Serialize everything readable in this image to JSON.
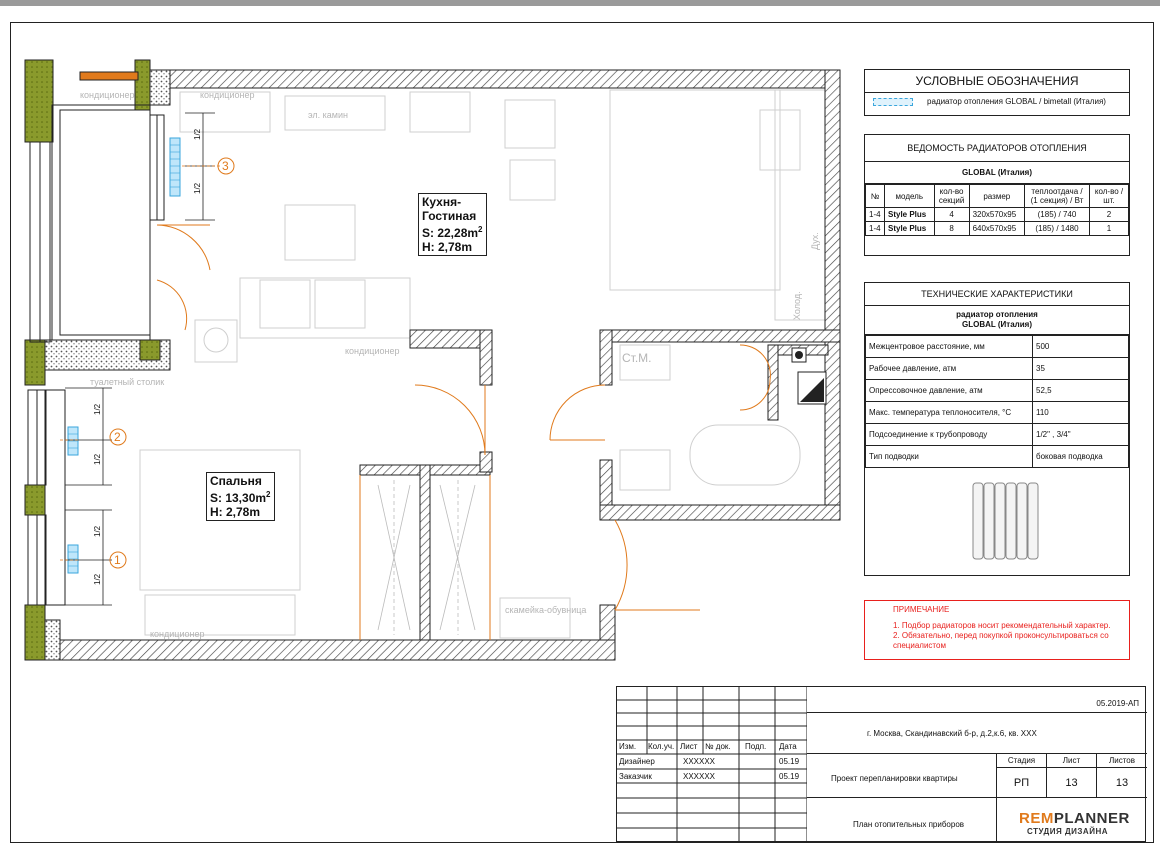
{
  "plan": {
    "rooms": [
      {
        "name_l1": "Кухня-",
        "name_l2": "Гостиная",
        "area": "S: 22,28m",
        "height": "H: 2,78m"
      },
      {
        "name_l1": "Спальня",
        "area": "S: 13,30m",
        "height": "H: 2,78m"
      }
    ],
    "sup": "2",
    "half": "1/2",
    "radiator_numbers": [
      "1",
      "2",
      "3"
    ],
    "ghost_labels": {
      "conditioner": "кондиционер",
      "fireplace": "эл. камин",
      "dressing_table": "туалетный столик",
      "bench": "скамейка-обувница",
      "washer": "Ст.М.",
      "fridge": "Холод.",
      "oven": "Дух."
    }
  },
  "legend": {
    "title": "УСЛОВНЫЕ ОБОЗНАЧЕНИЯ",
    "item": "радиатор отопления GLOBAL / bimetall (Италия)"
  },
  "radiators": {
    "title": "ВЕДОМОСТЬ РАДИАТОРОВ ОТОПЛЕНИЯ",
    "brand": "GLOBAL (Италия)",
    "headers": [
      "№",
      "модель",
      "кол-во секций",
      "размер",
      "теплоотдача / (1 секция) / Вт",
      "кол-во / шт."
    ],
    "rows": [
      [
        "1-4",
        "Style Plus",
        "4",
        "320x570x95",
        "(185) / 740",
        "2"
      ],
      [
        "1-4",
        "Style Plus",
        "8",
        "640x570x95",
        "(185) / 1480",
        "1"
      ]
    ]
  },
  "tech": {
    "title": "ТЕХНИЧЕСКИЕ ХАРАКТЕРИСТИКИ",
    "subtitle_l1": "радиатор отопления",
    "subtitle_l2": "GLOBAL (Италия)",
    "rows": [
      [
        "Межцентровое расстояние, мм",
        "500"
      ],
      [
        "Рабочее давление, атм",
        "35"
      ],
      [
        "Опрессовочное давление, атм",
        "52,5"
      ],
      [
        "Макс. температура теплоносителя, °С",
        "110"
      ],
      [
        "Подсоединение к трубопроводу",
        "1/2\" , 3/4\""
      ],
      [
        "Тип подводки",
        "боковая подводка"
      ]
    ]
  },
  "note": {
    "title": "ПРИМЕЧАНИЕ",
    "lines": [
      "1. Подбор радиаторов носит рекомендательный характер.",
      "2. Обязательно, перед покупкой проконсультироваться со специалистом"
    ]
  },
  "stamp": {
    "code": "05.2019-АП",
    "address": "г. Москва, Скандинавский б-р, д.2,к.6, кв. XXX",
    "cols": [
      "Изм.",
      "Кол.уч.",
      "Лист",
      "№ док.",
      "Подп.",
      "Дата"
    ],
    "designer": "Дизайнер",
    "client": "Заказчик",
    "xx": "XXXXXX",
    "date": "05.19",
    "project": "Проект перепланировки квартиры",
    "sheet_title": "План отопительных приборов",
    "stage_h": "Стадия",
    "sheet_h": "Лист",
    "sheets_h": "Листов",
    "stage": "РП",
    "sheet": "13",
    "sheets": "13"
  },
  "logo": {
    "rem": "REM",
    "planner": "PLANNER",
    "studio": "СТУДИЯ ДИЗАЙНА"
  },
  "colors": {
    "accent": "#e07a1c",
    "radiator": "#3aa6dc",
    "wall_fill": "#8a9a2c",
    "note": "#e8201d"
  }
}
